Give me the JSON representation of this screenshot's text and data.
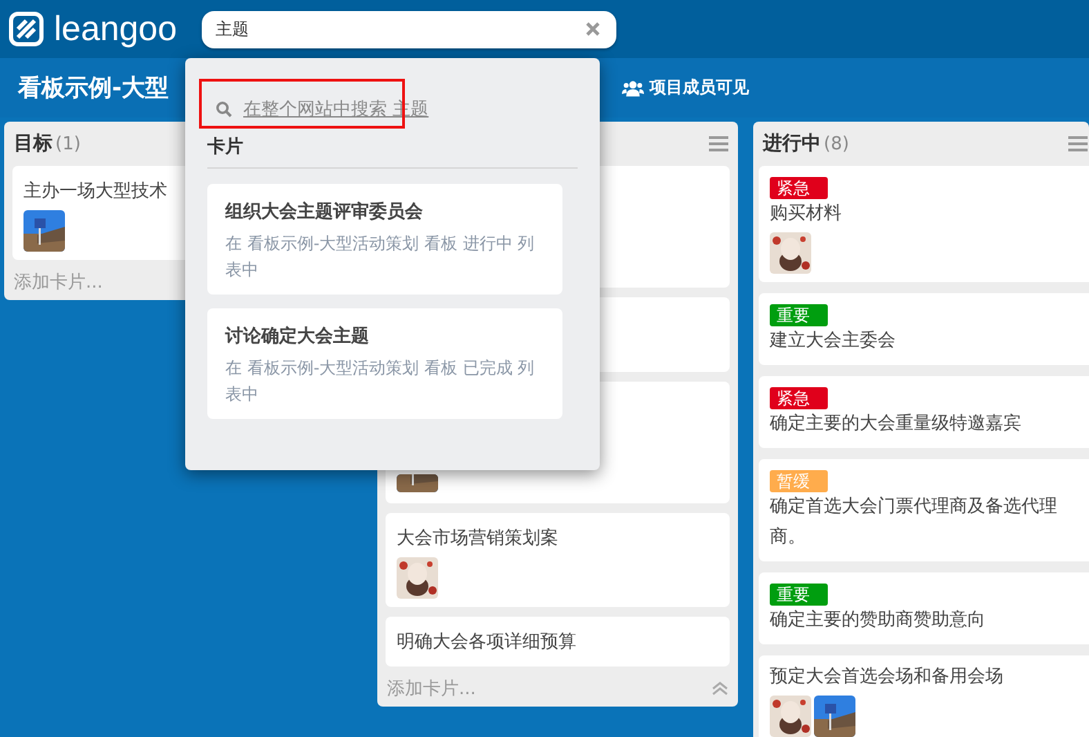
{
  "header": {
    "logo_text": "leangoo",
    "search": {
      "value": "主题"
    }
  },
  "board_bar": {
    "title": "看板示例-大型",
    "visibility": "项目成员可见"
  },
  "lists": [
    {
      "title": "目标",
      "count": "(1)",
      "cards": [
        {
          "kind": "normal",
          "title": "主办一场大型技术",
          "photos": [
            {
              "kind": "landscape"
            }
          ]
        }
      ],
      "add_card": "添加卡片...",
      "menu": false,
      "collapse": false
    },
    {
      "cards": [
        {
          "kind": "covered"
        },
        {
          "kind": "covered-short"
        },
        {
          "kind": "covered",
          "photos": [
            {
              "kind": "landscape"
            }
          ]
        },
        {
          "kind": "normal",
          "title": "大会市场营销策划案",
          "photos": [
            {
              "kind": "portrait"
            }
          ]
        },
        {
          "kind": "normal",
          "title": "明确大会各项详细预算"
        }
      ],
      "add_card": "添加卡片...",
      "menu": true,
      "collapse": true
    },
    {
      "title": "进行中",
      "count": "(8)",
      "menu": true,
      "cards": [
        {
          "kind": "normal",
          "label": {
            "text": "紧急",
            "color": "#e0001b"
          },
          "title": "购买材料",
          "photos": [
            {
              "kind": "portrait"
            }
          ]
        },
        {
          "kind": "normal",
          "label": {
            "text": "重要",
            "color": "#009e0f"
          },
          "title": "建立大会主委会"
        },
        {
          "kind": "normal",
          "label": {
            "text": "紧急",
            "color": "#e0001b"
          },
          "title": "确定主要的大会重量级特邀嘉宾"
        },
        {
          "kind": "normal",
          "label": {
            "text": "暂缓",
            "color": "#ffac4c"
          },
          "title": "确定首选大会门票代理商及备选代理商。"
        },
        {
          "kind": "normal",
          "label": {
            "text": "重要",
            "color": "#009e0f"
          },
          "title": "确定主要的赞助商赞助意向"
        },
        {
          "kind": "normal",
          "title": "预定大会首选会场和备用会场",
          "photos": [
            {
              "kind": "portrait"
            },
            {
              "kind": "landscape"
            }
          ]
        }
      ]
    }
  ],
  "search_popup": {
    "search_all": "在整个网站中搜索 主题",
    "section": "卡片",
    "results": [
      {
        "title": "组织大会主题评审委员会",
        "location": "在 看板示例-大型活动策划 看板 进行中 列表中"
      },
      {
        "title": "讨论确定大会主题",
        "location": "在 看板示例-大型活动策划 看板 已完成 列表中"
      }
    ]
  }
}
